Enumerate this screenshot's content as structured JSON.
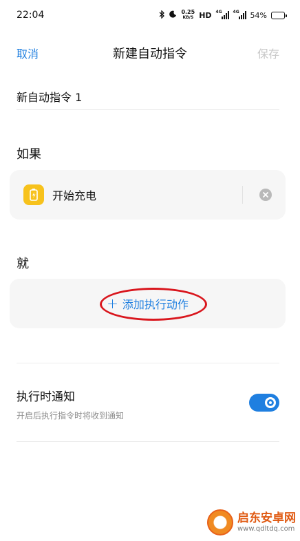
{
  "status_bar": {
    "time": "22:04",
    "net_speed": "0.25",
    "net_speed_unit": "KB/S",
    "hd": "HD",
    "signal1_tag": "4G",
    "signal2_tag": "4G",
    "battery_pct": "54%",
    "battery_level": 0.54
  },
  "nav": {
    "cancel_label": "取消",
    "title": "新建自动指令",
    "save_label": "保存"
  },
  "name_field": {
    "value": "新自动指令 1"
  },
  "if_section": {
    "label": "如果",
    "condition_label": "开始充电",
    "condition_icon": "battery-charging-icon",
    "remove_icon": "close-icon"
  },
  "then_section": {
    "label": "就",
    "add_action_label": "添加执行动作"
  },
  "notify": {
    "title": "执行时通知",
    "subtitle": "开启后执行指令时将收到通知",
    "enabled": true
  },
  "watermark": {
    "title": "启东安卓网",
    "url": "www.qdltdq.com"
  },
  "colors": {
    "accent": "#1f7fe0",
    "highlight": "#d9161d",
    "icon_yellow": "#f7c21c"
  }
}
